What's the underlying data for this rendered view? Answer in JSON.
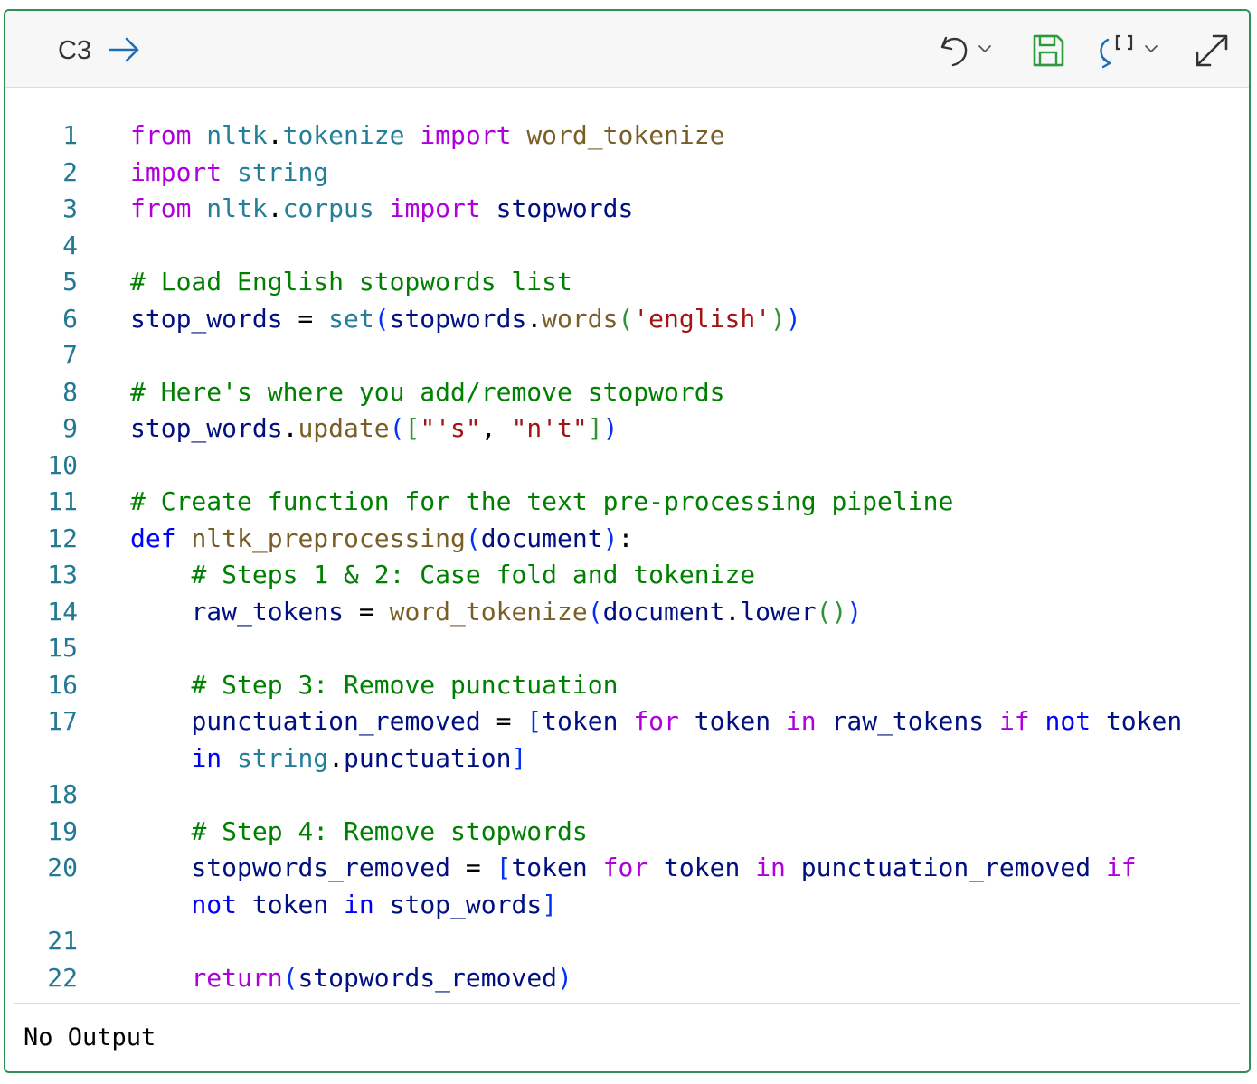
{
  "cell": {
    "id": "C3",
    "toolbar_icons": [
      "run-arrow-icon",
      "undo-icon",
      "chevron-down-icon",
      "save-icon",
      "refresh-brackets-icon",
      "expand-icon"
    ],
    "accent_color": "#2f8f55"
  },
  "code_lines": [
    {
      "n": "1",
      "tokens": [
        [
          "kw",
          "from"
        ],
        [
          "t",
          " "
        ],
        [
          "mod",
          "nltk"
        ],
        [
          "op",
          "."
        ],
        [
          "mod",
          "tokenize"
        ],
        [
          "t",
          " "
        ],
        [
          "kw",
          "import"
        ],
        [
          "t",
          " "
        ],
        [
          "fn",
          "word_tokenize"
        ]
      ]
    },
    {
      "n": "2",
      "tokens": [
        [
          "kw",
          "import"
        ],
        [
          "t",
          " "
        ],
        [
          "mod",
          "string"
        ]
      ]
    },
    {
      "n": "3",
      "tokens": [
        [
          "kw",
          "from"
        ],
        [
          "t",
          " "
        ],
        [
          "mod",
          "nltk"
        ],
        [
          "op",
          "."
        ],
        [
          "mod",
          "corpus"
        ],
        [
          "t",
          " "
        ],
        [
          "kw",
          "import"
        ],
        [
          "t",
          " "
        ],
        [
          "v",
          "stopwords"
        ]
      ]
    },
    {
      "n": "4",
      "tokens": []
    },
    {
      "n": "5",
      "tokens": [
        [
          "cm",
          "# Load English stopwords list"
        ]
      ]
    },
    {
      "n": "6",
      "tokens": [
        [
          "v",
          "stop_words"
        ],
        [
          "op",
          " = "
        ],
        [
          "mod",
          "set"
        ],
        [
          "p1",
          "("
        ],
        [
          "v",
          "stopwords"
        ],
        [
          "op",
          "."
        ],
        [
          "fn",
          "words"
        ],
        [
          "p2",
          "("
        ],
        [
          "str",
          "'english'"
        ],
        [
          "p2",
          ")"
        ],
        [
          "p1",
          ")"
        ]
      ]
    },
    {
      "n": "7",
      "tokens": []
    },
    {
      "n": "8",
      "tokens": [
        [
          "cm",
          "# Here's where you add/remove stopwords"
        ]
      ]
    },
    {
      "n": "9",
      "tokens": [
        [
          "v",
          "stop_words"
        ],
        [
          "op",
          "."
        ],
        [
          "fn",
          "update"
        ],
        [
          "p1",
          "("
        ],
        [
          "p2",
          "["
        ],
        [
          "str",
          "\"'s\""
        ],
        [
          "op",
          ", "
        ],
        [
          "str",
          "\"n't\""
        ],
        [
          "p2",
          "]"
        ],
        [
          "p1",
          ")"
        ]
      ]
    },
    {
      "n": "10",
      "tokens": []
    },
    {
      "n": "11",
      "tokens": [
        [
          "cm",
          "# Create function for the text pre-processing pipeline"
        ]
      ]
    },
    {
      "n": "12",
      "tokens": [
        [
          "kwb",
          "def"
        ],
        [
          "t",
          " "
        ],
        [
          "fn",
          "nltk_preprocessing"
        ],
        [
          "p1",
          "("
        ],
        [
          "v",
          "document"
        ],
        [
          "p1",
          ")"
        ],
        [
          "op",
          ":"
        ]
      ]
    },
    {
      "n": "13",
      "tokens": [
        [
          "t",
          "    "
        ],
        [
          "cm",
          "# Steps 1 & 2: Case fold and tokenize"
        ]
      ]
    },
    {
      "n": "14",
      "tokens": [
        [
          "t",
          "    "
        ],
        [
          "v",
          "raw_tokens"
        ],
        [
          "op",
          " = "
        ],
        [
          "fn",
          "word_tokenize"
        ],
        [
          "p1",
          "("
        ],
        [
          "v",
          "document"
        ],
        [
          "op",
          "."
        ],
        [
          "v",
          "lower"
        ],
        [
          "p2",
          "()"
        ],
        [
          "p1",
          ")"
        ]
      ]
    },
    {
      "n": "15",
      "tokens": []
    },
    {
      "n": "16",
      "tokens": [
        [
          "t",
          "    "
        ],
        [
          "cm",
          "# Step 3: Remove punctuation"
        ]
      ]
    },
    {
      "n": "17",
      "tokens": [
        [
          "t",
          "    "
        ],
        [
          "v",
          "punctuation_removed"
        ],
        [
          "op",
          " = "
        ],
        [
          "p1",
          "["
        ],
        [
          "v",
          "token"
        ],
        [
          "t",
          " "
        ],
        [
          "kw",
          "for"
        ],
        [
          "t",
          " "
        ],
        [
          "v",
          "token"
        ],
        [
          "t",
          " "
        ],
        [
          "kw",
          "in"
        ],
        [
          "t",
          " "
        ],
        [
          "v",
          "raw_tokens"
        ],
        [
          "t",
          " "
        ],
        [
          "kw",
          "if"
        ],
        [
          "t",
          " "
        ],
        [
          "kwb",
          "not"
        ],
        [
          "t",
          " "
        ],
        [
          "v",
          "token"
        ]
      ]
    },
    {
      "n": "",
      "tokens": [
        [
          "t",
          "    "
        ],
        [
          "kwb",
          "in"
        ],
        [
          "t",
          " "
        ],
        [
          "mod",
          "string"
        ],
        [
          "op",
          "."
        ],
        [
          "v",
          "punctuation"
        ],
        [
          "p1",
          "]"
        ]
      ]
    },
    {
      "n": "18",
      "tokens": []
    },
    {
      "n": "19",
      "tokens": [
        [
          "t",
          "    "
        ],
        [
          "cm",
          "# Step 4: Remove stopwords"
        ]
      ]
    },
    {
      "n": "20",
      "tokens": [
        [
          "t",
          "    "
        ],
        [
          "v",
          "stopwords_removed"
        ],
        [
          "op",
          " = "
        ],
        [
          "p1",
          "["
        ],
        [
          "v",
          "token"
        ],
        [
          "t",
          " "
        ],
        [
          "kw",
          "for"
        ],
        [
          "t",
          " "
        ],
        [
          "v",
          "token"
        ],
        [
          "t",
          " "
        ],
        [
          "kw",
          "in"
        ],
        [
          "t",
          " "
        ],
        [
          "v",
          "punctuation_removed"
        ],
        [
          "t",
          " "
        ],
        [
          "kw",
          "if"
        ]
      ]
    },
    {
      "n": "",
      "tokens": [
        [
          "t",
          "    "
        ],
        [
          "kwb",
          "not"
        ],
        [
          "t",
          " "
        ],
        [
          "v",
          "token"
        ],
        [
          "t",
          " "
        ],
        [
          "kwb",
          "in"
        ],
        [
          "t",
          " "
        ],
        [
          "v",
          "stop_words"
        ],
        [
          "p1",
          "]"
        ]
      ]
    },
    {
      "n": "21",
      "tokens": []
    },
    {
      "n": "22",
      "tokens": [
        [
          "t",
          "    "
        ],
        [
          "kw",
          "return"
        ],
        [
          "p1",
          "("
        ],
        [
          "v",
          "stopwords_removed"
        ],
        [
          "p1",
          ")"
        ]
      ]
    }
  ],
  "output": {
    "text": "No Output"
  }
}
